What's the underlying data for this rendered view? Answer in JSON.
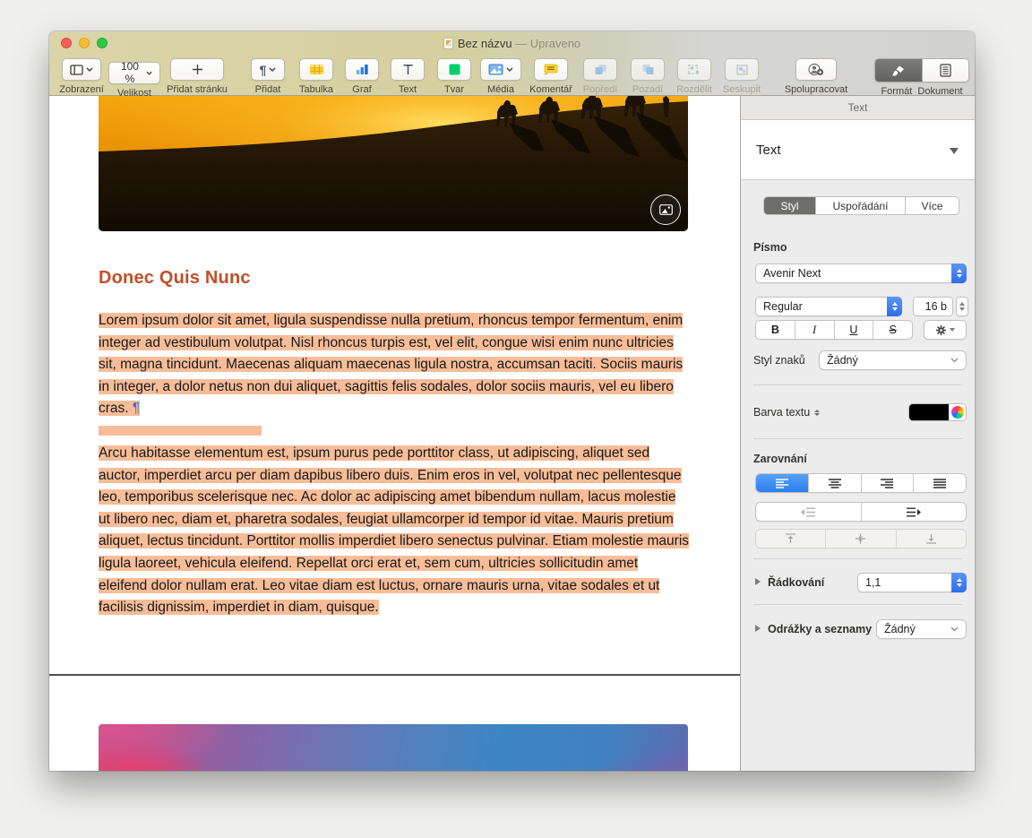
{
  "window": {
    "title": "Bez názvu",
    "title_state": "— Upraveno"
  },
  "toolbar": {
    "zobrazeni": "Zobrazení",
    "velikost": "Velikost",
    "velikost_value": "100 %",
    "pridat_stranku": "Přidat stránku",
    "pridat": "Přidat",
    "tabulka": "Tabulka",
    "graf": "Graf",
    "text": "Text",
    "tvar": "Tvar",
    "media": "Média",
    "komentar": "Komentář",
    "popredi": "Popředí",
    "pozadi": "Pozadí",
    "rozdelit": "Rozdělit",
    "seskupit": "Seskupit",
    "spolupracovat": "Spolupracovat",
    "format": "Formát",
    "dokument": "Dokument",
    "pilcrow_icon": "¶"
  },
  "sidebar": {
    "panel_title": "Text",
    "object_name": "Text",
    "tabs": [
      {
        "label": "Styl"
      },
      {
        "label": "Uspořádání"
      },
      {
        "label": "Více"
      }
    ],
    "font_section": "Písmo",
    "font_family": "Avenir Next",
    "font_style": "Regular",
    "font_size": "16 b",
    "bold": "B",
    "italic": "I",
    "underline": "U",
    "strikethrough": "S",
    "char_style_label": "Styl znaků",
    "char_style_value": "Žádný",
    "text_color_label": "Barva textu",
    "alignment_section": "Zarovnání",
    "line_spacing_label": "Řádkování",
    "line_spacing_value": "1,1",
    "bullets_label": "Odrážky a seznamy",
    "bullets_value": "Žádný"
  },
  "document": {
    "heading": "Donec Quis Nunc",
    "para1": "Lorem ipsum dolor sit amet, ligula suspendisse nulla pretium, rhoncus tempor fermentum, enim integer ad vestibulum volutpat. Nisl rhoncus turpis est, vel elit, congue wisi enim nunc ultricies sit, magna tincidunt. Maecenas aliquam maecenas ligula nostra, accumsan taciti. Sociis mauris in integer, a dolor netus non dui aliquet, sagittis felis sodales, dolor sociis mauris, vel eu libero cras. ",
    "pilcrow": "¶",
    "para2": "Arcu habitasse elementum est, ipsum purus pede porttitor class, ut adipiscing, aliquet sed auctor, imperdiet arcu per diam dapibus libero duis. Enim eros in vel, volutpat nec pellentesque leo, temporibus scelerisque nec. Ac dolor ac adipiscing amet bibendum nullam, lacus molestie ut libero nec, diam et, pharetra sodales, feugiat ullamcorper id tempor id vitae. Mauris pretium aliquet, lectus tincidunt. Porttitor mollis imperdiet libero senectus pulvinar. Etiam molestie mauris ligula laoreet, vehicula eleifend. Repellat orci erat et, sem cum, ultricies sollicitudin amet eleifend dolor nullam erat. Leo vitae diam est luctus, ornare mauris urna, vitae sodales et ut facilisis dignissim, imperdiet in diam, quisque."
  }
}
